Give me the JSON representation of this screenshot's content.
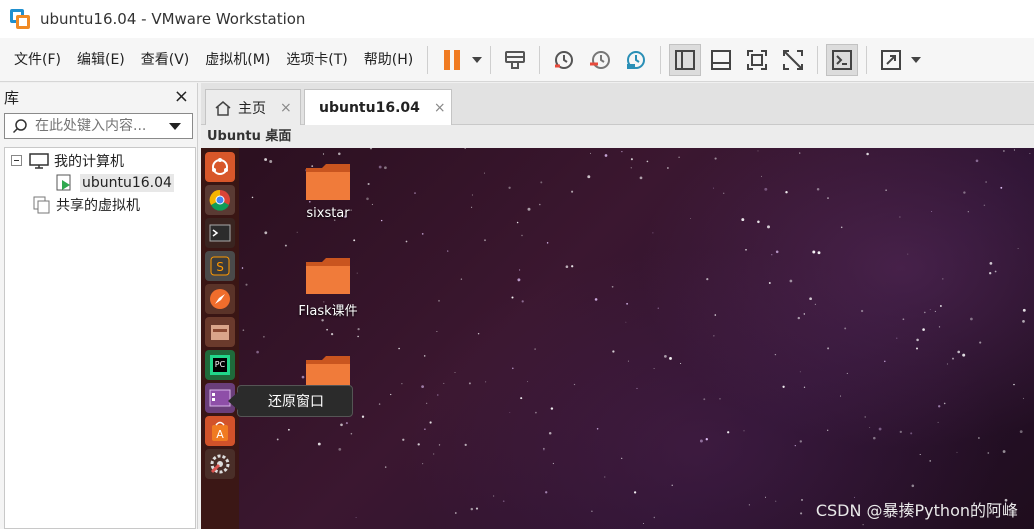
{
  "window": {
    "title": "ubuntu16.04 - VMware Workstation"
  },
  "menu": {
    "items": [
      {
        "label": "文件(F)"
      },
      {
        "label": "编辑(E)"
      },
      {
        "label": "查看(V)"
      },
      {
        "label": "虚拟机(M)"
      },
      {
        "label": "选项卡(T)"
      },
      {
        "label": "帮助(H)"
      }
    ]
  },
  "toolbar": {
    "icons": [
      "pause-icon",
      "send-keys-icon",
      "snapshot-icon",
      "revert-snapshot-icon",
      "snapshot-manager-icon",
      "library-view-icon",
      "thumbnail-bar-icon",
      "fullscreen-icon",
      "unity-icon",
      "console-icon",
      "stretch-icon"
    ],
    "accent": "#f07b22"
  },
  "library": {
    "title": "库",
    "close": "×",
    "search_placeholder": "在此处键入内容...",
    "tree": {
      "my_computer": "我的计算机",
      "vm": "ubuntu16.04",
      "shared": "共享的虚拟机"
    }
  },
  "tabs": [
    {
      "label": "主页",
      "close": "×"
    },
    {
      "label": "ubuntu16.04",
      "close": "×"
    }
  ],
  "vm": {
    "title": "Ubuntu 桌面",
    "desktop_icons": [
      {
        "label": "sixstar"
      },
      {
        "label": "Flask课件"
      }
    ],
    "launcher_icons": [
      "ubuntu-dash-icon",
      "chrome-icon",
      "terminal-icon",
      "sublime-text-icon",
      "browser-icon",
      "file-manager-icon",
      "pycharm-icon",
      "restore-window-icon",
      "software-center-icon",
      "system-settings-icon"
    ],
    "tooltip": "还原窗口"
  },
  "watermark": "CSDN @暴揍Python的阿峰"
}
